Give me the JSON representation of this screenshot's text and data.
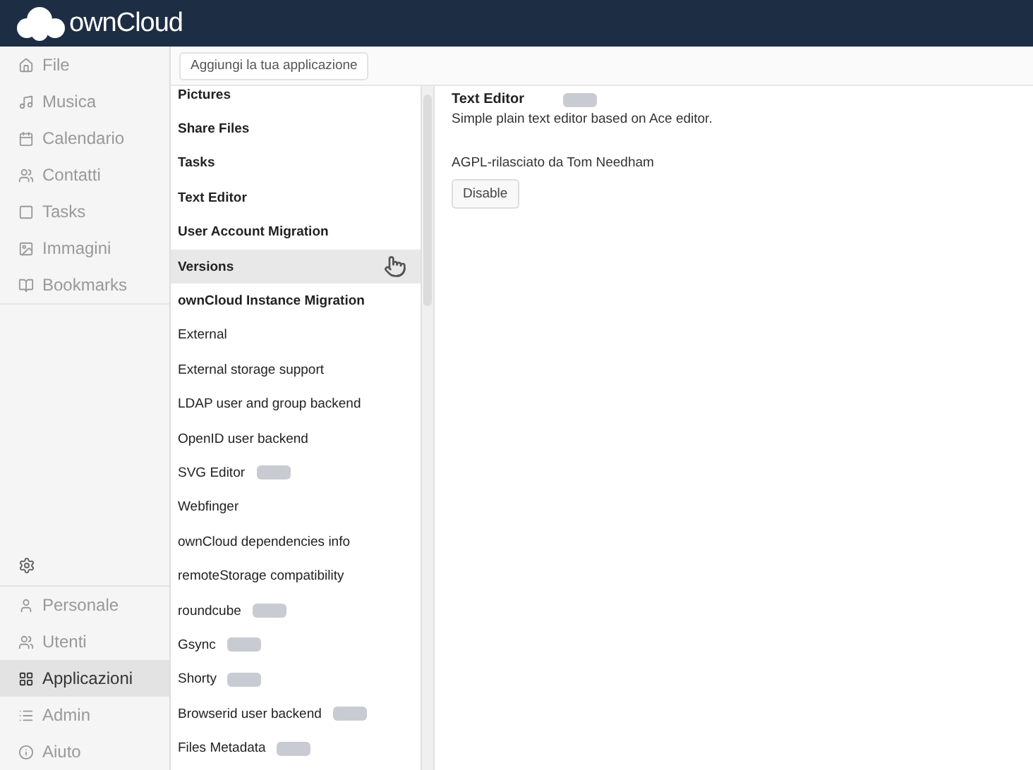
{
  "header": {
    "logo_text": "ownCloud"
  },
  "nav": {
    "top": [
      {
        "label": "File",
        "kind": "home",
        "selected": false
      },
      {
        "label": "Musica",
        "kind": "music",
        "selected": false
      },
      {
        "label": "Calendario",
        "kind": "calendar",
        "selected": false
      },
      {
        "label": "Contatti",
        "kind": "users",
        "selected": false
      },
      {
        "label": "Tasks",
        "kind": "square",
        "selected": false
      },
      {
        "label": "Immagini",
        "kind": "image",
        "selected": false
      },
      {
        "label": "Bookmarks",
        "kind": "book",
        "selected": false
      }
    ],
    "bottom": [
      {
        "label": "Personale",
        "kind": "user",
        "selected": false
      },
      {
        "label": "Utenti",
        "kind": "users",
        "selected": false
      },
      {
        "label": "Applicazioni",
        "kind": "grid",
        "selected": true
      },
      {
        "label": "Admin",
        "kind": "list",
        "selected": false
      },
      {
        "label": "Aiuto",
        "kind": "info",
        "selected": false
      }
    ]
  },
  "toolbar": {
    "add_button": "Aggiungi la tua applicazione"
  },
  "apps": [
    {
      "name": "Pictures",
      "enabled": true,
      "selected": false,
      "badge": false
    },
    {
      "name": "Share Files",
      "enabled": true,
      "selected": false,
      "badge": false
    },
    {
      "name": "Tasks",
      "enabled": true,
      "selected": false,
      "badge": false
    },
    {
      "name": "Text Editor",
      "enabled": true,
      "selected": false,
      "badge": false
    },
    {
      "name": "User Account Migration",
      "enabled": true,
      "selected": false,
      "badge": false
    },
    {
      "name": "Versions",
      "enabled": true,
      "selected": true,
      "badge": false
    },
    {
      "name": "ownCloud Instance Migration",
      "enabled": true,
      "selected": false,
      "badge": false
    },
    {
      "name": "External",
      "enabled": false,
      "selected": false,
      "badge": false
    },
    {
      "name": "External storage support",
      "enabled": false,
      "selected": false,
      "badge": false
    },
    {
      "name": "LDAP user and group backend",
      "enabled": false,
      "selected": false,
      "badge": false
    },
    {
      "name": "OpenID user backend",
      "enabled": false,
      "selected": false,
      "badge": false
    },
    {
      "name": "SVG Editor",
      "enabled": false,
      "selected": false,
      "badge": true
    },
    {
      "name": "Webfinger",
      "enabled": false,
      "selected": false,
      "badge": false
    },
    {
      "name": "ownCloud dependencies info",
      "enabled": false,
      "selected": false,
      "badge": false
    },
    {
      "name": "remoteStorage compatibility",
      "enabled": false,
      "selected": false,
      "badge": false
    },
    {
      "name": "roundcube",
      "enabled": false,
      "selected": false,
      "badge": true
    },
    {
      "name": "Gsync",
      "enabled": false,
      "selected": false,
      "badge": true
    },
    {
      "name": "Shorty",
      "enabled": false,
      "selected": false,
      "badge": true
    },
    {
      "name": "Browserid user backend",
      "enabled": false,
      "selected": false,
      "badge": true
    },
    {
      "name": "Files Metadata",
      "enabled": false,
      "selected": false,
      "badge": true
    }
  ],
  "detail": {
    "title": "Text Editor",
    "badge": true,
    "description": "Simple plain text editor based on Ace editor.",
    "license": "AGPL-rilasciato da Tom Needham",
    "button": "Disable"
  }
}
